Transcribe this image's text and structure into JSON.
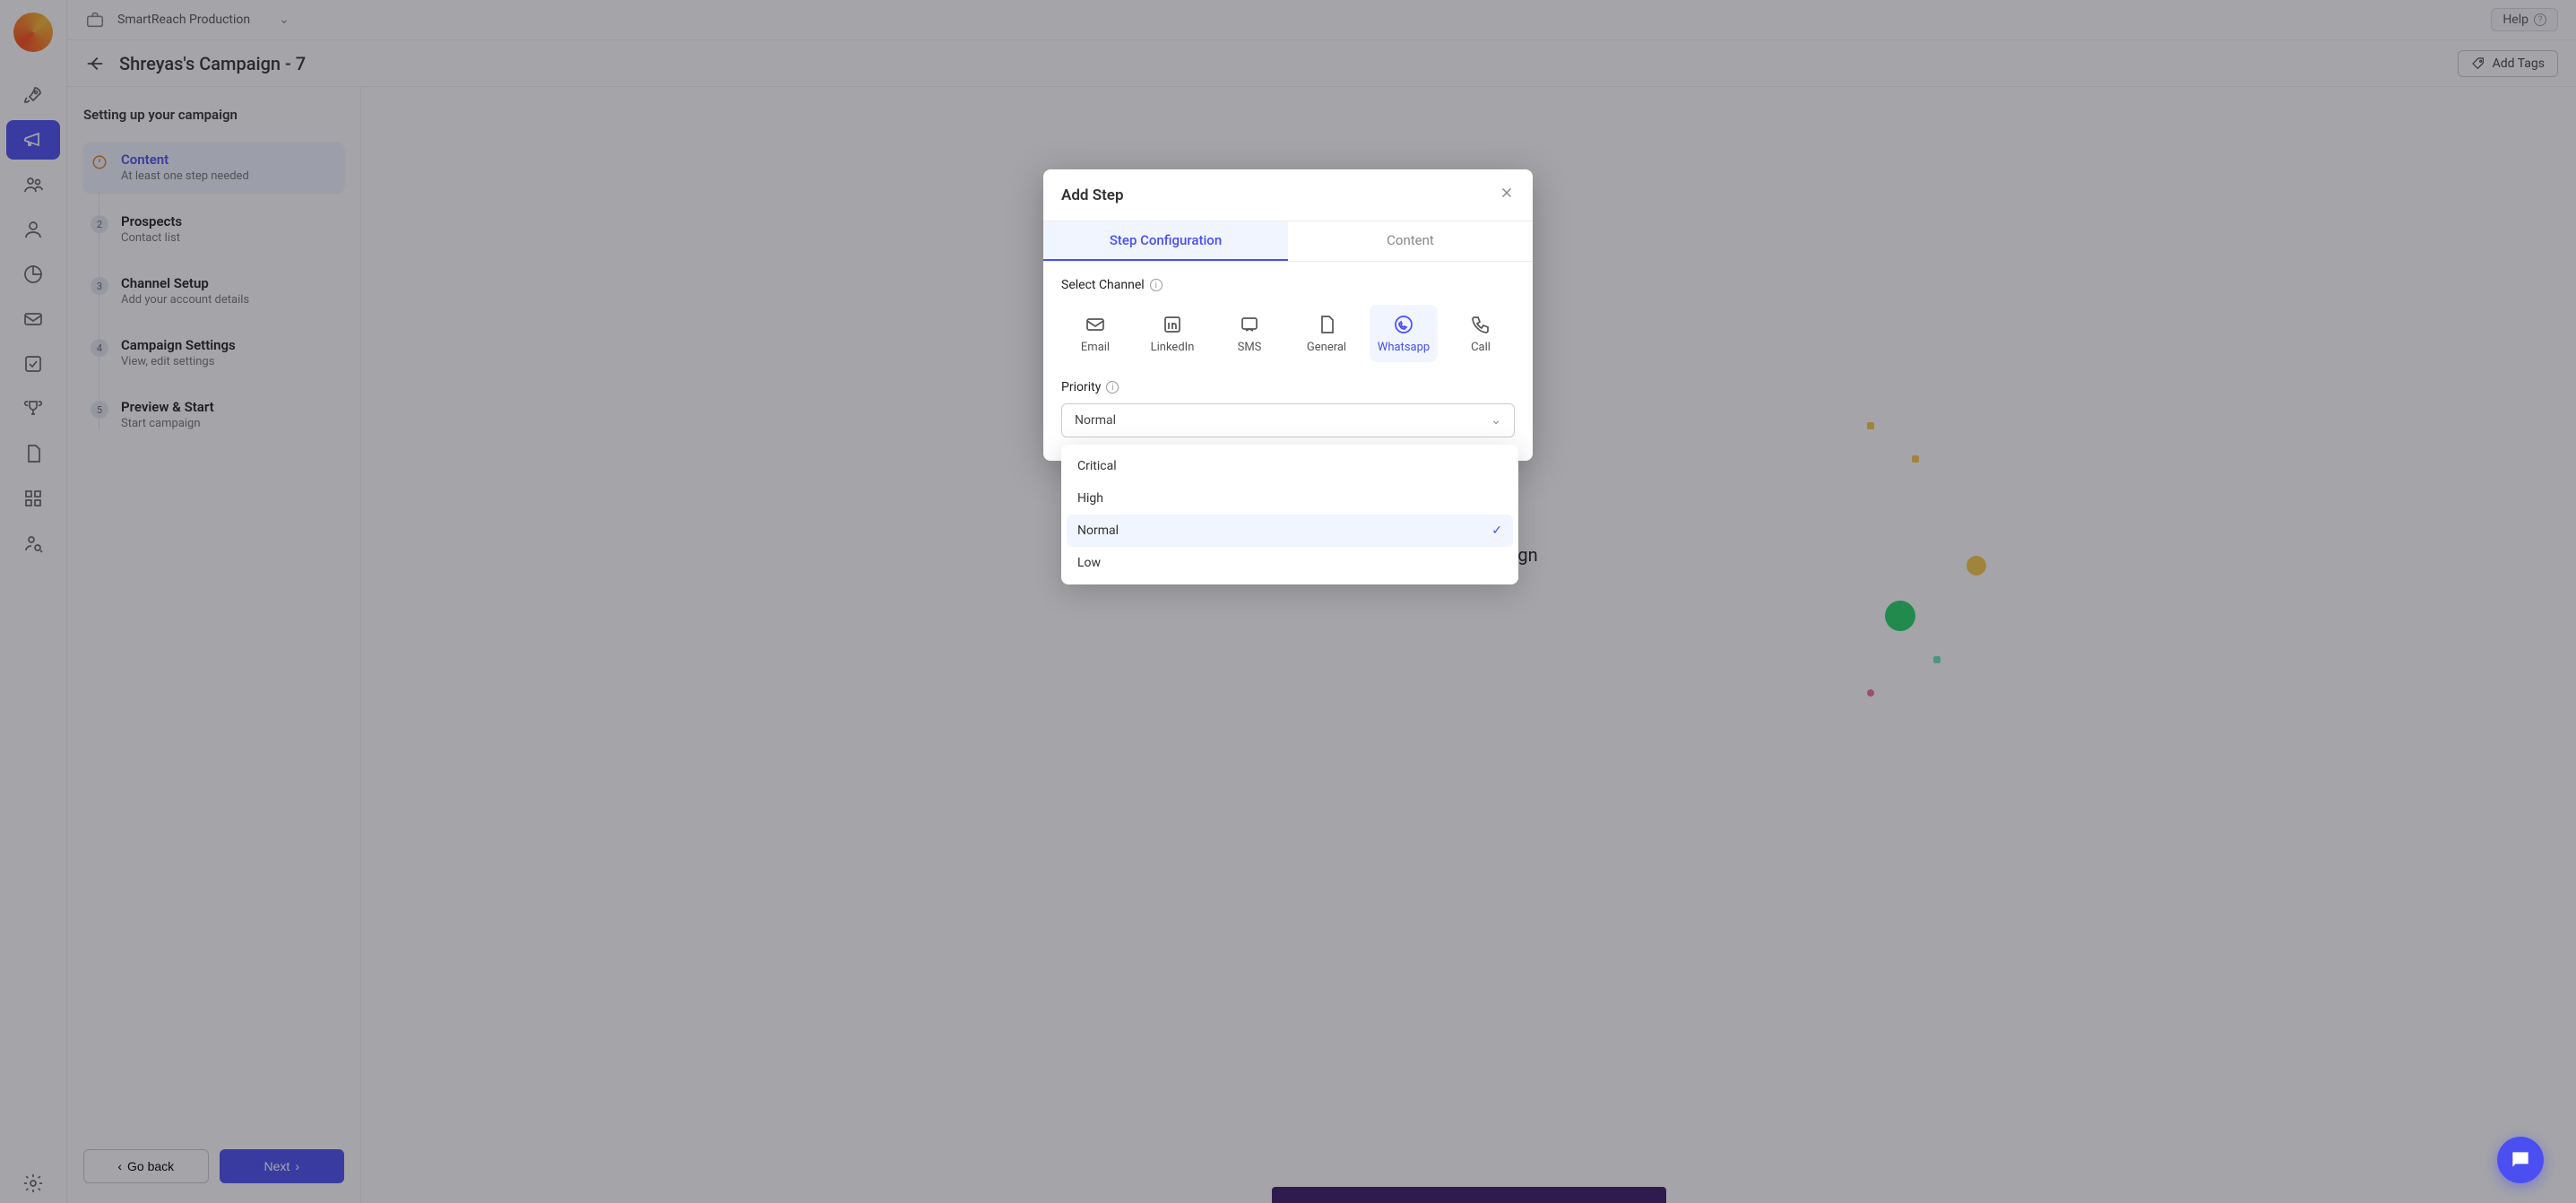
{
  "topbar": {
    "workspace": "SmartReach Production",
    "help_label": "Help"
  },
  "header": {
    "campaign_title": "Shreyas's Campaign - 7",
    "add_tags_label": "Add Tags"
  },
  "setup": {
    "heading": "Setting up your campaign",
    "steps": [
      {
        "title": "Content",
        "subtitle": "At least one step needed",
        "badge": "!"
      },
      {
        "title": "Prospects",
        "subtitle": "Contact list",
        "badge": "2"
      },
      {
        "title": "Channel Setup",
        "subtitle": "Add your account details",
        "badge": "3"
      },
      {
        "title": "Campaign Settings",
        "subtitle": "View, edit settings",
        "badge": "4"
      },
      {
        "title": "Preview & Start",
        "subtitle": "Start campaign",
        "badge": "5"
      }
    ],
    "go_back_label": "Go back",
    "next_label": "Next"
  },
  "stage": {
    "message_suffix": "to your campaign"
  },
  "modal": {
    "title": "Add Step",
    "tabs": {
      "config": "Step Configuration",
      "content": "Content"
    },
    "select_channel_label": "Select Channel",
    "channels": {
      "email": "Email",
      "linkedin": "LinkedIn",
      "sms": "SMS",
      "general": "General",
      "whatsapp": "Whatsapp",
      "call": "Call"
    },
    "priority_label": "Priority",
    "priority_value": "Normal",
    "priority_options": {
      "critical": "Critical",
      "high": "High",
      "normal": "Normal",
      "low": "Low"
    }
  },
  "colors": {
    "accent": "#4b4ff2",
    "accent_bg": "#f0f5ff"
  }
}
